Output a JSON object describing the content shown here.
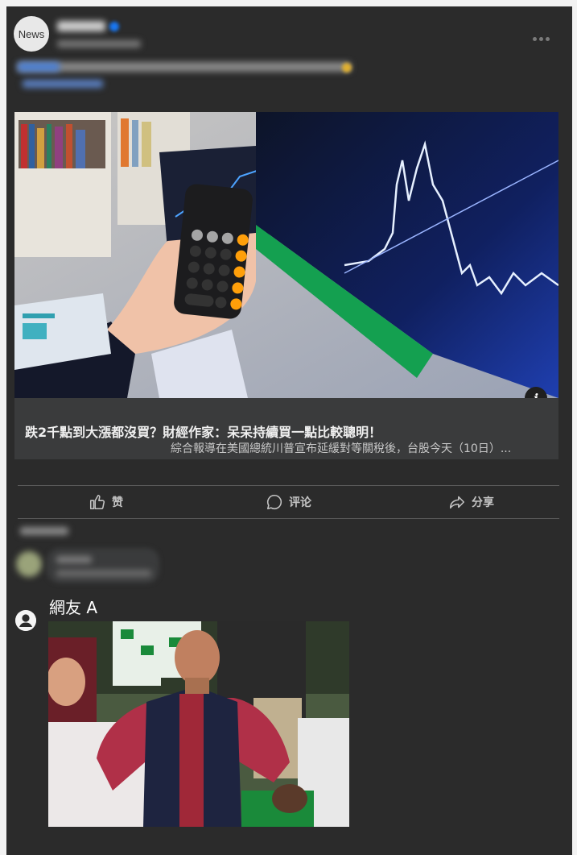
{
  "post": {
    "avatar_text": "News",
    "link_preview": {
      "headline": "跌2千點到大漲都沒買？財經作家：呆呆持續買一點比較聰明！",
      "description": "綜合報導在美國總統川普宣布延緩對等關稅後，台股今天（10日）..."
    },
    "actions": {
      "like_label": "赞",
      "comment_label": "评论",
      "share_label": "分享"
    }
  },
  "reply": {
    "name": "網友 A"
  },
  "icons": {
    "more": "more-options-icon",
    "info": "info-icon",
    "like": "thumbs-up-icon",
    "comment": "speech-bubble-icon",
    "share": "share-arrow-icon",
    "user": "user-silhouette-icon"
  },
  "colors": {
    "card_background": "#2b2b2b",
    "preview_background": "#3a3b3c",
    "verified_badge": "#1877f2"
  }
}
